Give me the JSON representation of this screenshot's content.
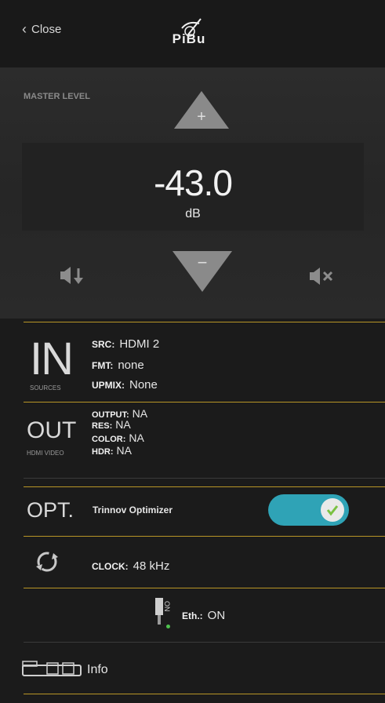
{
  "header": {
    "close_label": "Close",
    "logo_text": "PiBu"
  },
  "master": {
    "label": "MASTER LEVEL",
    "plus_symbol": "+",
    "minus_symbol": "−",
    "value": "-43.0",
    "unit": "dB"
  },
  "input": {
    "title": "IN",
    "caption": "SOURCES",
    "src_label": "SRC:",
    "src_value": "HDMI 2",
    "fmt_label": "FMT:",
    "fmt_value": "none",
    "upmix_label": "UPMIX:",
    "upmix_value": "None"
  },
  "output": {
    "title": "OUT",
    "caption": "HDMI VIDEO",
    "output_label": "OUTPUT:",
    "output_value": "NA",
    "res_label": "RES:",
    "res_value": "NA",
    "color_label": "COLOR:",
    "color_value": "NA",
    "hdr_label": "HDR:",
    "hdr_value": "NA"
  },
  "optimizer": {
    "title": "OPT.",
    "label": "Trinnov Optimizer",
    "enabled": true
  },
  "clock": {
    "label": "CLOCK:",
    "value": "48 kHz"
  },
  "ethernet": {
    "plug_text": "ON",
    "label": "Eth.:",
    "value": "ON"
  },
  "info": {
    "label": "Info"
  },
  "colors": {
    "accent_gold": "#b89526",
    "toggle_teal": "#2fa3b6",
    "check_green": "#7ac142"
  },
  "icons": {
    "back": "chevron-left-icon",
    "volume_down": "volume-down-icon",
    "mute": "mute-icon",
    "sync": "sync-icon",
    "ethernet": "ethernet-plug-icon",
    "info": "projector-icon"
  }
}
